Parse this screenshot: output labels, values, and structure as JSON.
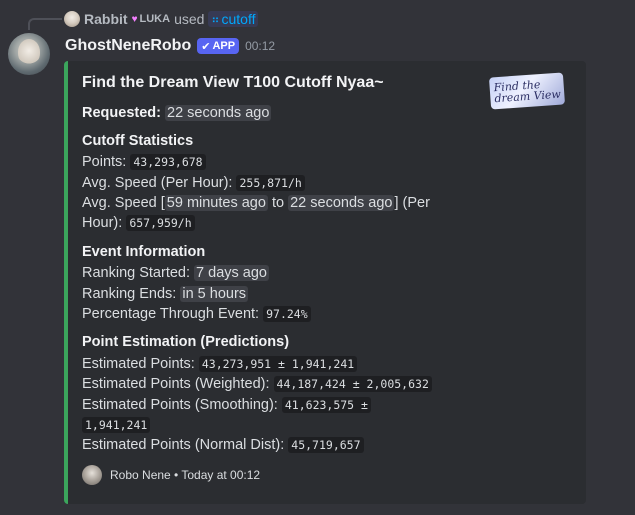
{
  "reply": {
    "user": "Rabbit",
    "badge": "LUKA",
    "verb": "used",
    "command": "cutoff"
  },
  "message": {
    "author": "GhostNeneRobo",
    "app_badge": "APP",
    "time": "00:12"
  },
  "embed": {
    "accent_color": "#3ba55c",
    "title": "Find the Dream View T100 Cutoff Nyaa~",
    "thumbnail_text_1": "Find the",
    "thumbnail_text_2": "dream View",
    "requested_label": "Requested:",
    "requested_value": "22 seconds ago",
    "cutoff": {
      "title": "Cutoff Statistics",
      "points_label": "Points:",
      "points_value": "43,293,678",
      "avg_label": "Avg. Speed (Per Hour):",
      "avg_value": "255,871/h",
      "avg2_prefix": "Avg. Speed [",
      "avg2_from": "59 minutes ago",
      "avg2_to_word": "to",
      "avg2_to": "22 seconds ago",
      "avg2_suffix": "] (Per",
      "avg2_line2": "Hour):",
      "avg2_value": "657,959/h"
    },
    "event": {
      "title": "Event Information",
      "started_label": "Ranking Started:",
      "started_value": "7 days ago",
      "ends_label": "Ranking Ends:",
      "ends_value": "in 5 hours",
      "pct_label": "Percentage Through Event:",
      "pct_value": "97.24%"
    },
    "estimation": {
      "title": "Point Estimation (Predictions)",
      "est_label": "Estimated Points:",
      "est_value": "43,273,951 ± 1,941,241",
      "weighted_label": "Estimated Points (Weighted):",
      "weighted_value": "44,187,424 ± 2,005,632",
      "smooth_label": "Estimated Points (Smoothing):",
      "smooth_value": "41,623,575 ±",
      "smooth_value2": "1,941,241",
      "normal_label": "Estimated Points (Normal Dist):",
      "normal_value": "45,719,657"
    },
    "footer": {
      "text": "Robo Nene • Today at 00:12"
    }
  }
}
